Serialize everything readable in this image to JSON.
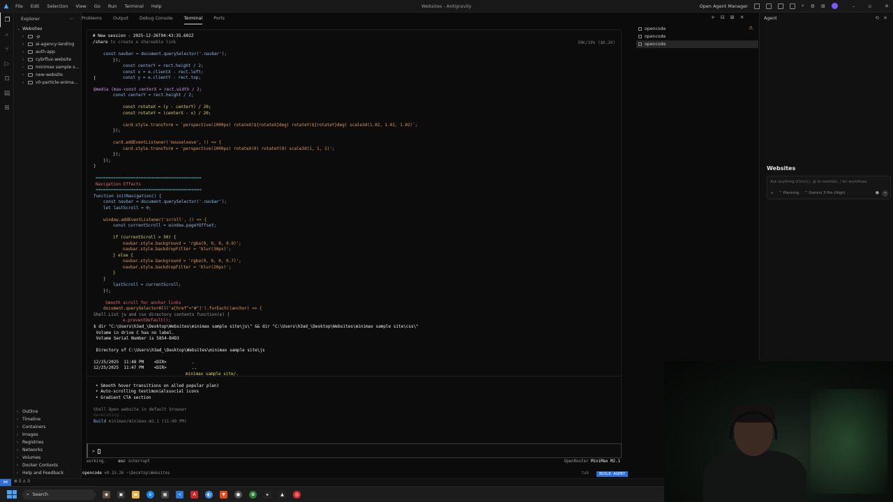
{
  "window": {
    "title": "Websites - Antigravity",
    "agent_manager": "Open Agent Manager"
  },
  "menu": [
    "File",
    "Edit",
    "Selection",
    "View",
    "Go",
    "Run",
    "Terminal",
    "Help"
  ],
  "explorer": {
    "header": "Explorer",
    "root": "Websites",
    "items": [
      "-p",
      "ai-agency-landing",
      "auth-app",
      "cybrflux-website",
      "minimax sample s...",
      "new-website",
      "v0-particle-anima..."
    ],
    "sections": [
      "Outline",
      "Timeline",
      "Containers",
      "Images",
      "Registries",
      "Networks",
      "Volumes",
      "Docker Contexts",
      "Help and Feedback"
    ]
  },
  "panel_tabs": [
    "Problems",
    "Output",
    "Debug Console",
    "Terminal",
    "Ports"
  ],
  "terminal": {
    "session_line": "# New session - 2025-12-26T04:43:35.602Z",
    "share_cmd": "/share",
    "share_text": " to create a shareable link",
    "tokens": "39K/19% ($0.20)",
    "code": {
      "l1": "const navbar = document.querySelector('.navbar');",
      "l2": "});",
      "l3": "const centerY = rect.height / 2;",
      "l4": "const x = e.clientX - rect.left;",
      "l5": "const y = e.clientY - rect.top;",
      "l6": "[",
      "l7": "@media (max-const centerX = rect.width / 2;",
      "l8": "const centerY = rect.height / 2;",
      "l9": "const rotateX = (y - centerY) / 20;",
      "l10": "const rotateY = (centerX - x) / 20;",
      "l11": "card.style.transform = `perspective(1000px) rotateX(${rotateX}deg) rotateY(${rotateY}deg) scale3d(1.02, 1.02, 1.02)`;",
      "l12": "});",
      "l13": "card.addEventListener('mouseleave', () => {",
      "l14": "card.style.transform = 'perspective(1000px) rotateX(0) rotateY(0) scale3d(1, 1, 1)';",
      "l15": "});",
      "l16": "});",
      "l17": "}",
      "l18": "==========================================",
      "l19": "Navigation Effects",
      "l20": "==========================================",
      "l21": "function initNavigation() {",
      "l22": "const navbar = document.querySelector('.navbar');",
      "l23": "let lastScroll = 0;",
      "l24": "window.addEventListener('scroll', () => {",
      "l25": "const currentScroll = window.pageYOffset;",
      "l26": "if (currentScroll > 50) {",
      "l27": "navbar.style.background = 'rgba(0, 0, 0, 0.9)';",
      "l28": "navbar.style.backdropFilter = 'blur(30px)';",
      "l29": "} else {",
      "l30": "navbar.style.background = 'rgba(0, 0, 0, 0.7)';",
      "l31": "navbar.style.backdropFilter = 'blur(20px)';",
      "l32": "}",
      "l33": "}",
      "l34": "lastScroll = currentScroll;",
      "l35": "});",
      "l36": "Smooth scroll for anchor links",
      "l37": "document.querySelectorAll('a[href^=\"#\"]').forEach((anchor) => {",
      "l38": "Shell List js and css directory contents function(e) {",
      "l39": "e.preventDefault();"
    },
    "dir_cmd": "$ dir \"C:\\Users\\h3ad_\\Desktop\\Websites\\minimax sample site\\js\\\" && dir \"C:\\Users\\h3ad_\\Desktop\\Websites\\minimax sample site\\css\\\"",
    "vol1": " Volume in drive C has no label.",
    "vol2": " Volume Serial Number is 5854-B4D3",
    "dirof": " Directory of C:\\Users\\h3ad_\\Desktop\\Websites\\minimax sample site\\js",
    "d1": "12/25/2025  11:48 PM    <DIR>          .",
    "d2": "12/25/2025  11:47 PM    <DIR>          ..",
    "site": "minimax sample site/.",
    "bullets": [
      "Smooth hover transitions on alled popular plan)",
      "Auto-scrolling testimonialssocial icons",
      "Gradient CTA section"
    ],
    "shell_open": "Shell Open website in default browser",
    "generating": "Generating...",
    "build": "Build",
    "build_model": " minimax/minimax-m2.1 (11:49 PM)",
    "prompt": ">",
    "working": "working.",
    "esc": "esc",
    "interrupt": " interrupt",
    "provider": "OpenRouter",
    "model": "MiniMax M2.1",
    "footer_app": "opencode",
    "footer_ver": " v0.15.26",
    "footer_path": "  ~\\Desktop\\Websites",
    "tab_label": "tab",
    "build_agent": "BUILD AGENT"
  },
  "opencode_list": [
    "opencode",
    "opencode",
    "opencode"
  ],
  "agent": {
    "header": "Agent",
    "workspace": "Websites",
    "placeholder": "Ask anything (Ctrl+L), @ to mention, / for workflows",
    "planning": "Planning",
    "model": "Gemini 3 Pro (High)"
  },
  "statusbar": {
    "errors": "⊗ 0 ⚠ 0"
  },
  "taskbar": {
    "search": "Search"
  }
}
